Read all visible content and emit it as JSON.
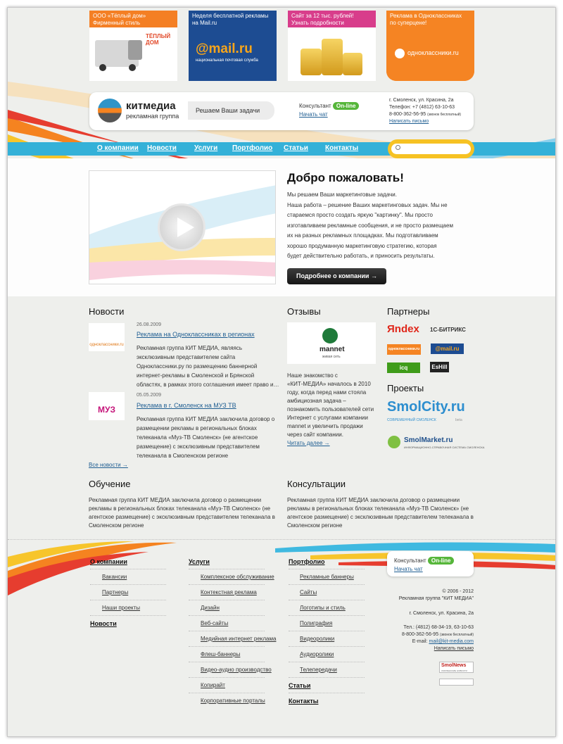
{
  "banners": [
    {
      "line1": "ООО «Тёплый дом»",
      "line2": "Фирменный стиль",
      "logo": "ТЁПЛЫЙ ДОМ"
    },
    {
      "line1": "Неделя бесплатной рекламы",
      "line2": "на Mail.ru",
      "logo": "@mail.ru",
      "logo_sub": "национальная почтовая служба"
    },
    {
      "line1": "Сайт за 12 тыс. рублей!",
      "line2": "Узнать подробности"
    },
    {
      "line1": "Реклама в Одноклассниках",
      "line2": "по суперцене!",
      "logo": "одноклассники.ru"
    }
  ],
  "header": {
    "brand": "китмедиа",
    "brand_sub": "рекламная группа",
    "slogan": "Решаем Ваши задачи",
    "consultant_label": "Консультант",
    "online_label": "On-line",
    "chat_link": "Начать чат",
    "address": "г. Смоленск, ул. Красина, 2а",
    "phone": "Телефон: +7 (4812) 63-10-63",
    "tollfree": "8-800-362-56-95",
    "tollfree_note": "(звонок бесплатный)",
    "write_link": "Написать письмо"
  },
  "nav": [
    "О компании",
    "Новости",
    "Услуги",
    "Портфолио",
    "Статьи",
    "Контакты"
  ],
  "search": {
    "placeholder": ""
  },
  "hero": {
    "title": "Добро пожаловать!",
    "lines": [
      "Мы решаем Ваши маркетинговые задачи.",
      "Наша работа – решение Ваших маркетинговых задач. Мы не",
      "стараемся просто создать яркую \"картинку\". Мы просто",
      "изготавливаем рекламные сообщения, и не просто размещаем",
      "их на разных рекламных площадках. Мы подготавливаем",
      "хорошо продуманную маркетинговую стратегию, которая",
      "будет действительно работать, и приносить результаты."
    ],
    "button": "Подробнее о компании →"
  },
  "news": {
    "title": "Новости",
    "items": [
      {
        "date": "26.08.2009",
        "title": "Реклама на Одноклассниках в регионах",
        "thumb": "одноклассники.ru",
        "lines": [
          "Рекламная группа КИТ МЕДИА, являясь",
          "эксклюзивным представителем сайта",
          "Одноклассники.ру по размещению баннерной",
          "интернет-рекламы в  Смоленской  и  Брянской",
          "областях, в рамках этого соглашения имеет право и…"
        ]
      },
      {
        "date": "05.05.2009",
        "title": "Реклама в г. Смоленск на МУЗ ТВ",
        "thumb": "МУЗ",
        "lines": [
          "Рекламная группа КИТ МЕДИА заключила договор о",
          "размещении рекламы в региональных блоках",
          "телеканала «Муз-ТВ Смоленск» (не агентское",
          "размещение) с эксклюзивным представителем",
          "телеканала в Смоленском регионе"
        ]
      }
    ],
    "all_link": "Все новости →"
  },
  "reviews": {
    "title": "Отзывы",
    "logo": "mannet",
    "logo_sub": "живая сеть",
    "lines": [
      "Наше знакомство с",
      "«КИТ-МЕДИА» началось в 2010",
      "году, когда перед нами стояла",
      "амбициозная задача –",
      "познакомить пользователей сети",
      "Интернет с услугами компании",
      "mannet и увеличить продажи",
      "через сайт компании."
    ],
    "more_link": "Читать далее →"
  },
  "partners": {
    "title": "Партнеры",
    "logos": [
      "Яndex",
      "1С-БИТРИКС",
      "одноклассники.ru",
      "@mail.ru",
      "icq",
      "EsHill"
    ]
  },
  "projects": {
    "title": "Проекты",
    "smolcity": "SmolCity.ru",
    "smolcity_sub": "СОВРЕМЕННЫЙ СМОЛЕНСК",
    "smolcity_beta": "beta",
    "smolmarket": "SmolMarket.ru",
    "smolmarket_sub": "ИНФОРМАЦИОННО-СПРАВОЧНАЯ СИСТЕМА СМОЛЕНСКА"
  },
  "training": {
    "title": "Обучение",
    "lines": [
      "Рекламная группа КИТ МЕДИА заключила договор о размещении",
      "рекламы в региональных блоках телеканала «Муз-ТВ Смоленск» (не",
      "агентское размещение) с эксклюзивным представителем телеканала в",
      "Смоленском регионе"
    ]
  },
  "consult": {
    "title": "Консультации",
    "lines": [
      "Рекламная группа КИТ МЕДИА заключила договор о размещении",
      "рекламы в региональных блоках телеканала «Муз-ТВ Смоленск» (не",
      "агентское размещение) с эксклюзивным представителем телеканала в",
      "Смоленском регионе"
    ]
  },
  "footer": {
    "col1": {
      "title": "О компании",
      "items": [
        "Вакансии",
        "Партнеры",
        "Наши проекты"
      ],
      "title2": "Новости"
    },
    "col2": {
      "title": "Услуги",
      "items": [
        "Комплексное обслуживание",
        "Контекстная реклама",
        "Дизайн",
        "Веб-сайты",
        "Медийная интернет реклама",
        "Флеш-баннеры",
        "Видео-аудио производство",
        "Копирайт",
        "Корпоративные порталы"
      ]
    },
    "col3": {
      "title": "Портфолио",
      "items": [
        "Рекламные баннеры",
        "Сайты",
        "Логотипы и стиль",
        "Полиграфия",
        "Видеоролики",
        "Аудиоролики",
        "Телепередачи"
      ],
      "title2": "Статьи",
      "title3": "Контакты"
    },
    "consultant_label": "Консультант",
    "online_label": "On-line",
    "chat_link": "Начать чат",
    "copyright": "© 2006 - 2012",
    "company": "Рекламная группа \"КИТ МЕДИА\"",
    "address": "г. Смоленск, ул. Красина, 2а",
    "tel": "Тел.: (4812) 68-34-19, 63-10-63",
    "tollfree": "8-800-362-56-95",
    "tollfree_note": "(звонок бесплатный)",
    "email_label": "E-mail:",
    "email": "mail@kit-media.com",
    "write_link": "Написать письмо",
    "badge": "SmolNews",
    "badge_sub": "СМОЛЕНСКИЕ НОВОСТИ"
  },
  "colors": {
    "nav": "#34b1d8",
    "search": "#f6c223",
    "online": "#56b63a",
    "link": "#1f5e92"
  }
}
